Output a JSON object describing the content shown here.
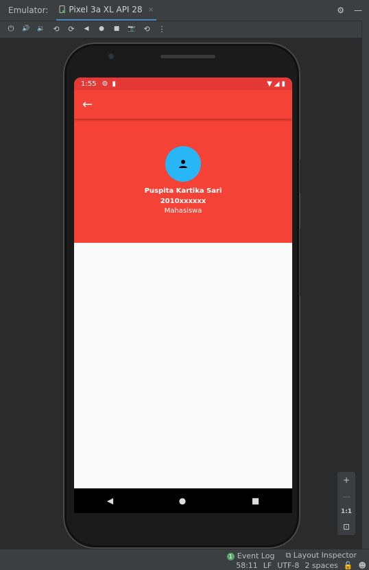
{
  "ide": {
    "emulator_label": "Emulator:",
    "device_tab": "Pixel 3a XL API 28",
    "tab_close": "×",
    "settings_glyph": "⚙",
    "minimize_glyph": "—"
  },
  "toolbar": {
    "icons": [
      "power-icon",
      "volume-up-icon",
      "volume-down-icon",
      "rotate-left-icon",
      "rotate-right-icon",
      "back-icon",
      "home-icon",
      "overview-icon",
      "screenshot-icon",
      "snapshot-icon",
      "more-icon"
    ],
    "glyphs": [
      "⏻",
      "🔊",
      "🔉",
      "⟲",
      "⟳",
      "◀",
      "●",
      "■",
      "📷",
      "⟲",
      "⋮"
    ]
  },
  "phone": {
    "status": {
      "time": "1:55",
      "left_icons": [
        "⚙",
        "▮"
      ],
      "right_icons": [
        "▼",
        "◢",
        "▮"
      ]
    },
    "appbar": {
      "back_glyph": "←"
    },
    "profile": {
      "name": "Puspita Kartika Sari",
      "nim": "2010xxxxxx",
      "role": "Mahasiswa"
    },
    "nav": {
      "back": "◀",
      "home": "●",
      "recents": "■"
    }
  },
  "zoom": {
    "plus": "+",
    "minus": "—",
    "ratio": "1:1",
    "fit": "⊡"
  },
  "status": {
    "event_log_count": "1",
    "event_log": "Event Log",
    "layout_inspector": "Layout Inspector",
    "position": "58:11",
    "line_sep": "LF",
    "encoding": "UTF-8",
    "indent": "2 spaces"
  },
  "colors": {
    "appbar": "#f44336",
    "statusbar": "#e53935",
    "avatar": "#29b6f6"
  }
}
